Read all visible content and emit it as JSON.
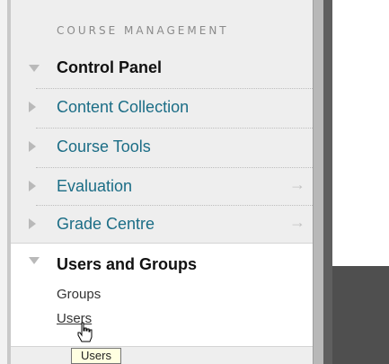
{
  "sidebar": {
    "section_heading": "COURSE MANAGEMENT",
    "items": [
      {
        "label": "Control Panel",
        "expanded": true,
        "bold": true
      },
      {
        "label": "Content Collection",
        "expanded": false
      },
      {
        "label": "Course Tools",
        "expanded": false
      },
      {
        "label": "Evaluation",
        "expanded": false,
        "has_arrow": true
      },
      {
        "label": "Grade Centre",
        "expanded": false,
        "has_arrow": true
      }
    ],
    "users_and_groups": {
      "title": "Users and Groups",
      "subitems": [
        "Groups",
        "Users"
      ]
    },
    "arrow_glyph": "→"
  },
  "tooltip": {
    "text": "Users"
  },
  "colors": {
    "link": "#1b6d86",
    "panel_bg": "#eeeeee",
    "tooltip_bg": "#ffffe1"
  }
}
